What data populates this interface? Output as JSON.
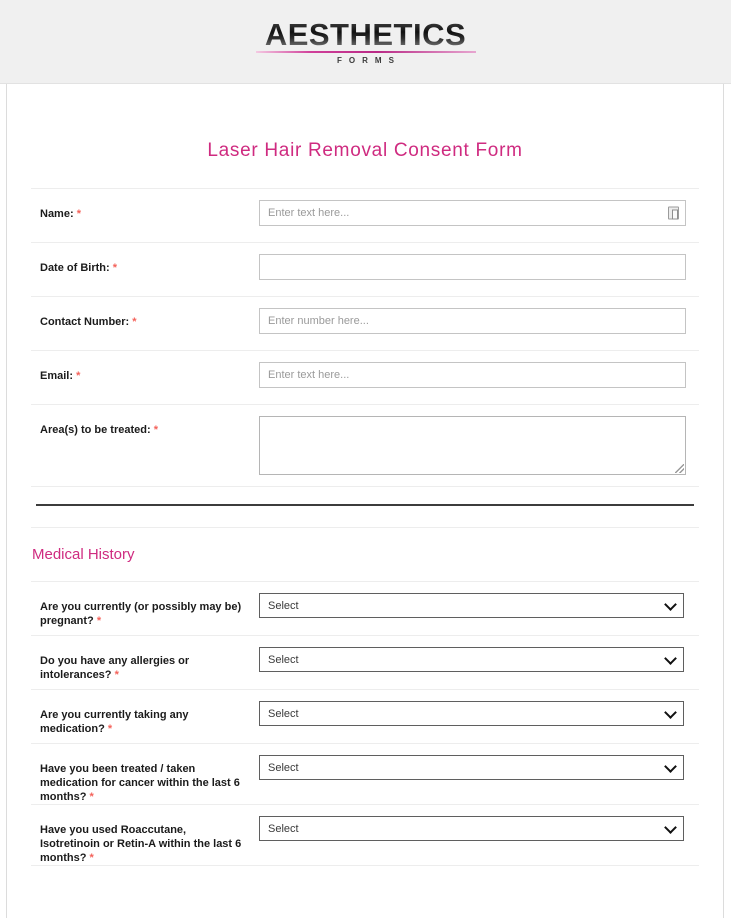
{
  "header": {
    "logo_main": "AESTHETICS",
    "logo_sub": "FORMS"
  },
  "form": {
    "title": "Laser Hair Removal Consent Form",
    "required_marker": "*",
    "fields": [
      {
        "label": "Name:",
        "type": "text",
        "placeholder": "Enter text here...",
        "value": "",
        "required": true,
        "icon": "contact-card-icon"
      },
      {
        "label": "Date of Birth:",
        "type": "text",
        "placeholder": "",
        "value": "",
        "required": true
      },
      {
        "label": "Contact Number:",
        "type": "text",
        "placeholder": "Enter number here...",
        "value": "",
        "required": true
      },
      {
        "label": "Email:",
        "type": "text",
        "placeholder": "Enter text here...",
        "value": "",
        "required": true
      },
      {
        "label": "Area(s) to be treated:",
        "type": "textarea",
        "placeholder": "",
        "value": "",
        "required": true
      }
    ]
  },
  "medical_history": {
    "heading": "Medical History",
    "questions": [
      {
        "label": "Are you currently (or possibly may be) pregnant?",
        "selected": "Select",
        "required": true
      },
      {
        "label": "Do you have any allergies or intolerances?",
        "selected": "Select",
        "required": true
      },
      {
        "label": "Are you currently taking any medication?",
        "selected": "Select",
        "required": true
      },
      {
        "label": "Have you been treated / taken medication for cancer within the last 6 months?",
        "selected": "Select",
        "required": true
      },
      {
        "label": "Have you used Roaccutane, Isotretinoin or Retin-A within the last 6 months?",
        "selected": "Select",
        "required": true
      }
    ]
  },
  "colors": {
    "accent_pink": "#cf2b80",
    "required_red": "#f4625a",
    "header_bg": "#f0f0f0",
    "border_gray": "#c4c4c4"
  }
}
